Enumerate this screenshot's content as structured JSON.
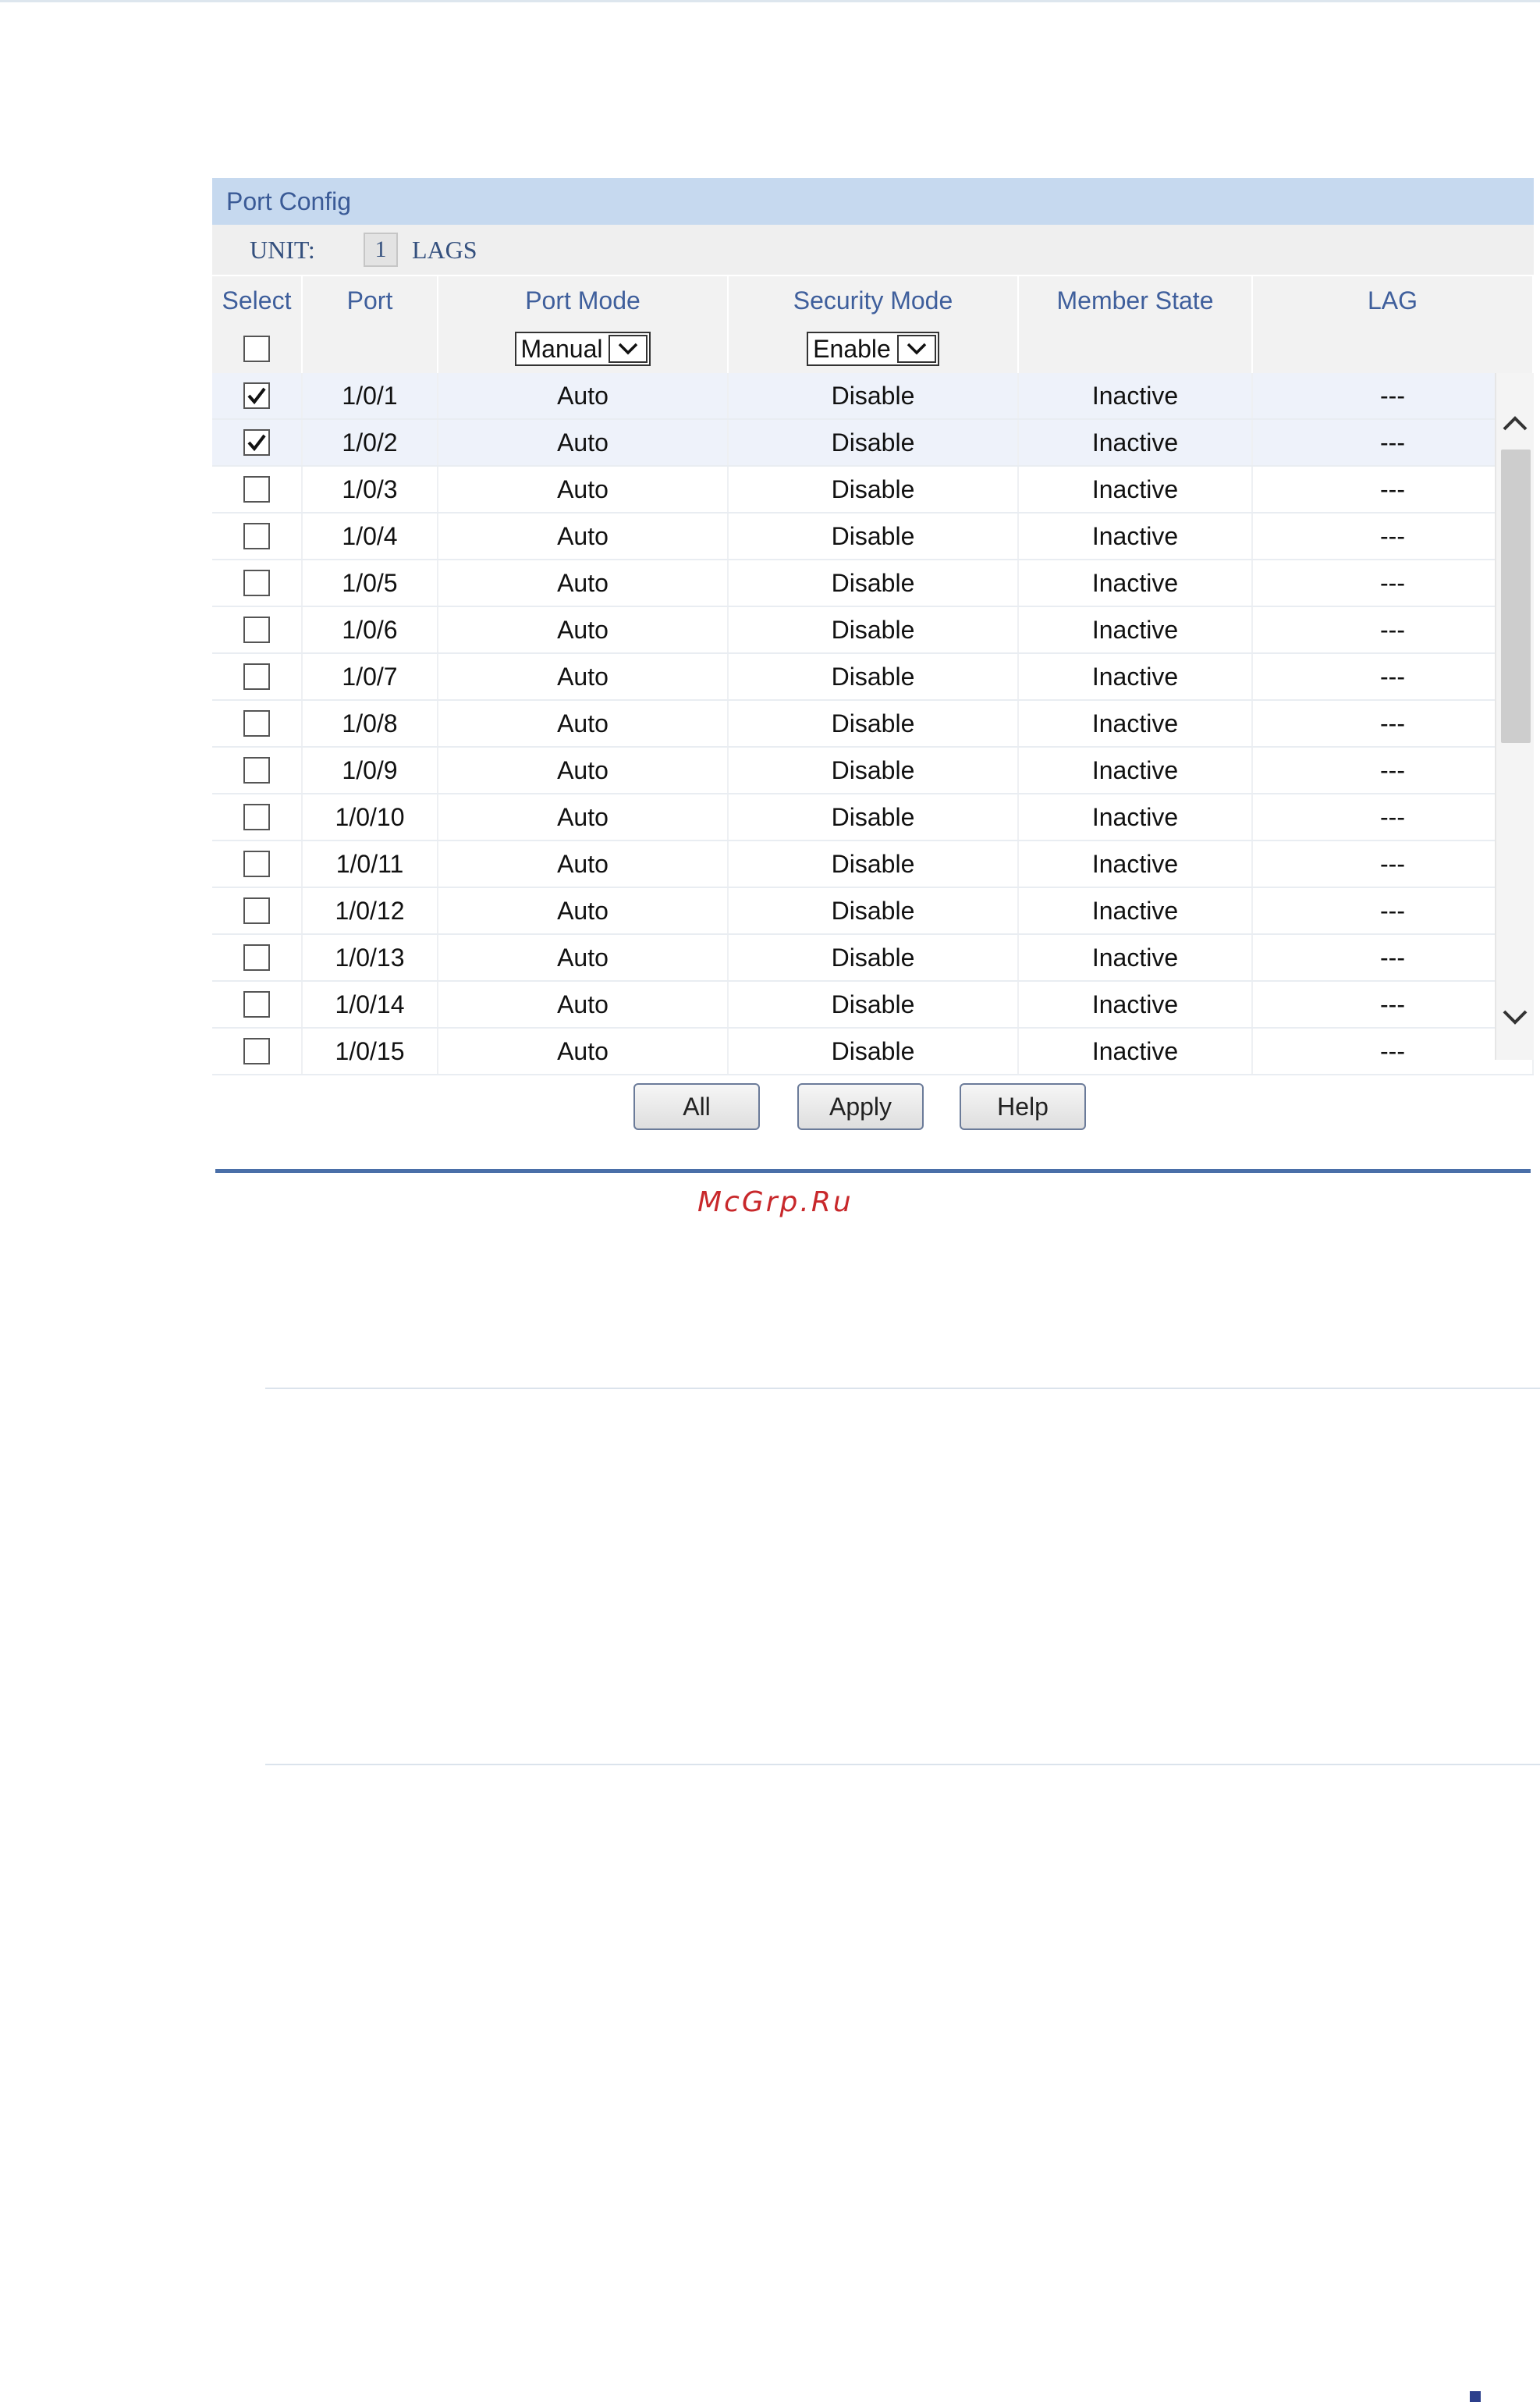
{
  "panel": {
    "title": "Port Config",
    "unit_label": "UNIT:",
    "unit_value": "1",
    "lags_label": "LAGS"
  },
  "columns": [
    "Select",
    "Port",
    "Port Mode",
    "Security Mode",
    "Member State",
    "LAG"
  ],
  "controls": {
    "port_mode_value": "Manual",
    "security_mode_value": "Enable",
    "select_all_checked": false
  },
  "rows": [
    {
      "checked": true,
      "port": "1/0/1",
      "port_mode": "Auto",
      "security_mode": "Disable",
      "member_state": "Inactive",
      "lag": "---"
    },
    {
      "checked": true,
      "port": "1/0/2",
      "port_mode": "Auto",
      "security_mode": "Disable",
      "member_state": "Inactive",
      "lag": "---"
    },
    {
      "checked": false,
      "port": "1/0/3",
      "port_mode": "Auto",
      "security_mode": "Disable",
      "member_state": "Inactive",
      "lag": "---"
    },
    {
      "checked": false,
      "port": "1/0/4",
      "port_mode": "Auto",
      "security_mode": "Disable",
      "member_state": "Inactive",
      "lag": "---"
    },
    {
      "checked": false,
      "port": "1/0/5",
      "port_mode": "Auto",
      "security_mode": "Disable",
      "member_state": "Inactive",
      "lag": "---"
    },
    {
      "checked": false,
      "port": "1/0/6",
      "port_mode": "Auto",
      "security_mode": "Disable",
      "member_state": "Inactive",
      "lag": "---"
    },
    {
      "checked": false,
      "port": "1/0/7",
      "port_mode": "Auto",
      "security_mode": "Disable",
      "member_state": "Inactive",
      "lag": "---"
    },
    {
      "checked": false,
      "port": "1/0/8",
      "port_mode": "Auto",
      "security_mode": "Disable",
      "member_state": "Inactive",
      "lag": "---"
    },
    {
      "checked": false,
      "port": "1/0/9",
      "port_mode": "Auto",
      "security_mode": "Disable",
      "member_state": "Inactive",
      "lag": "---"
    },
    {
      "checked": false,
      "port": "1/0/10",
      "port_mode": "Auto",
      "security_mode": "Disable",
      "member_state": "Inactive",
      "lag": "---"
    },
    {
      "checked": false,
      "port": "1/0/11",
      "port_mode": "Auto",
      "security_mode": "Disable",
      "member_state": "Inactive",
      "lag": "---"
    },
    {
      "checked": false,
      "port": "1/0/12",
      "port_mode": "Auto",
      "security_mode": "Disable",
      "member_state": "Inactive",
      "lag": "---"
    },
    {
      "checked": false,
      "port": "1/0/13",
      "port_mode": "Auto",
      "security_mode": "Disable",
      "member_state": "Inactive",
      "lag": "---"
    },
    {
      "checked": false,
      "port": "1/0/14",
      "port_mode": "Auto",
      "security_mode": "Disable",
      "member_state": "Inactive",
      "lag": "---"
    },
    {
      "checked": false,
      "port": "1/0/15",
      "port_mode": "Auto",
      "security_mode": "Disable",
      "member_state": "Inactive",
      "lag": "---"
    }
  ],
  "buttons": {
    "all": "All",
    "apply": "Apply",
    "help": "Help"
  },
  "watermark": "McGrp.Ru",
  "colors": {
    "title_bar": "#c6d9ef",
    "header_text": "#3f5f9c",
    "selected_row": "#eef2fa",
    "rule": "#4a6fa8",
    "watermark": "#c8282b"
  },
  "icons": {
    "scroll_up": "chevron-up-icon",
    "scroll_down": "chevron-down-icon",
    "dropdown": "chevron-down-icon",
    "check": "check-icon"
  }
}
